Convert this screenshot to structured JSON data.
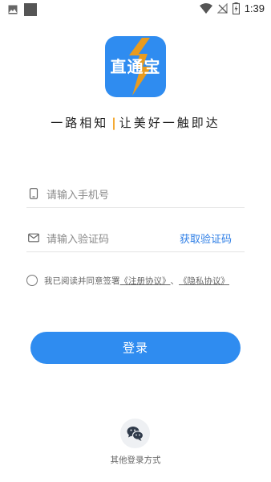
{
  "status_bar": {
    "time": "1:39"
  },
  "logo": {
    "text": "直通宝",
    "bg_color": "#2f8cf0",
    "bolt_color": "#f39c12"
  },
  "slogan": {
    "left": "一路相知",
    "separator": "|",
    "right": "让美好一触即达"
  },
  "form": {
    "phone_placeholder": "请输入手机号",
    "code_placeholder": "请输入验证码",
    "get_code_label": "获取验证码"
  },
  "agreement": {
    "prefix": "我已阅读并同意签署",
    "register_link": "《注册协议》",
    "separator": "、",
    "privacy_link": "《隐私协议》"
  },
  "login_button": {
    "label": "登录"
  },
  "other_login": {
    "label": "其他登录方式",
    "icon": "wechat-icon"
  },
  "colors": {
    "accent": "#2f8cf0",
    "link": "#2f7fe6",
    "orange": "#f39c12"
  }
}
